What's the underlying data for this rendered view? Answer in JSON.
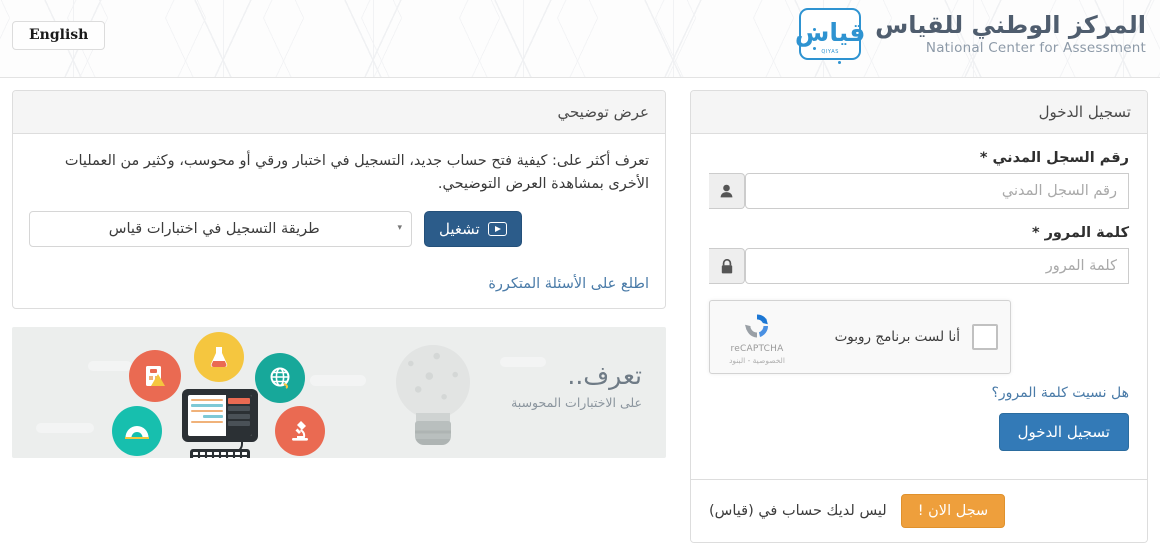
{
  "header": {
    "lang_button": "English",
    "brand_ar": "المركز الوطني للقياس",
    "brand_en": "National Center for Assessment",
    "logo_glyph": "قياس",
    "logo_sub": "QIYAS"
  },
  "demo_panel": {
    "title": "عرض توضيحي",
    "description": "تعرف أكثر على: كيفية فتح حساب جديد، التسجيل في اختبار ورقي أو محوسب، وكثير من العمليات الأخرى بمشاهدة العرض التوضيحي.",
    "select_value": "طريقة التسجيل في اختبارات قياس",
    "play_button": "تشغيل",
    "faq_link": "اطلع على الأسئلة المتكررة"
  },
  "banner": {
    "title": "تعرف..",
    "subtitle": "على الاختبارات المحوسبة"
  },
  "login_panel": {
    "title": "تسجيل الدخول",
    "id_label": "رقم السجل المدني *",
    "id_placeholder": "رقم السجل المدني",
    "id_value": "",
    "password_label": "كلمة المرور *",
    "password_placeholder": "كلمة المرور",
    "password_value": "",
    "forgot_link": "هل نسيت كلمة المرور؟",
    "submit_button": "تسجيل الدخول",
    "no_account_text": "ليس لديك حساب في (قياس)",
    "register_button": "سجل الان !"
  },
  "recaptcha": {
    "label": "أنا لست برنامج روبوت",
    "brand": "reCAPTCHA",
    "terms": "الخصوصية - البنود"
  },
  "icons": {
    "user": "user-icon",
    "lock": "lock-icon",
    "caret": "▾",
    "play": "play-icon"
  },
  "colors": {
    "primary": "#337ab7",
    "warning": "#ee9f3c",
    "play_button": "#2c5c8a",
    "brand_blue": "#2e93d1",
    "link": "#4a7ba8"
  }
}
